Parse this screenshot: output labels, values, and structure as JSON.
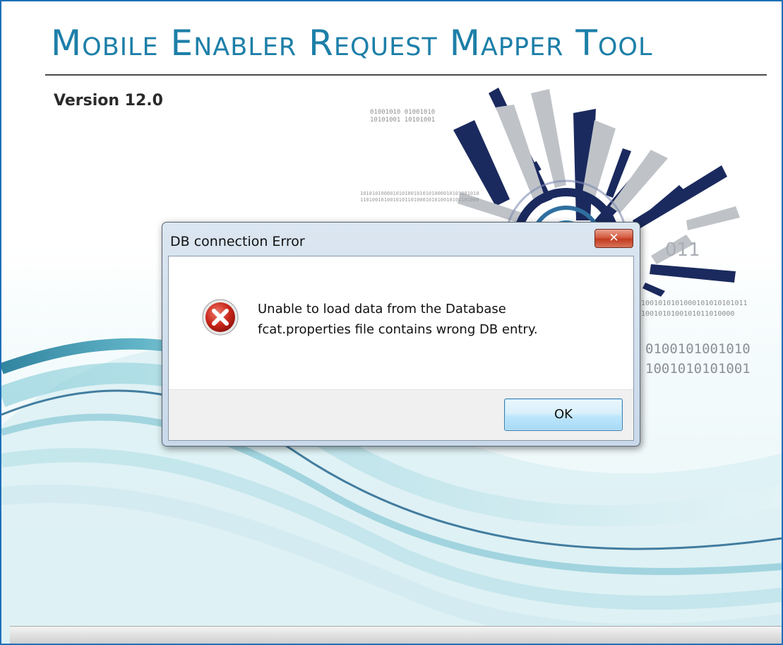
{
  "app": {
    "title": "Mobile Enabler Request Mapper Tool",
    "version": "Version 12.0",
    "binary_small": [
      "01001010  01001010",
      "10101001  10101001"
    ],
    "binary_mid": [
      "1010101000010101001010101000010101001010",
      "1101001010010101101000101010010101101000"
    ],
    "binary_right": [
      "1001010101000101010101011",
      "1001010100101011010000"
    ],
    "binary_large": [
      "0100101001010",
      "1001010101001"
    ],
    "binary_emblem": "011"
  },
  "dialog": {
    "title": "DB connection Error",
    "close_glyph": "✕",
    "icon": "error-icon",
    "message_line1": "Unable to load data from the Database",
    "message_line2": "fcat.properties file contains wrong DB entry.",
    "ok_label": "OK"
  },
  "colors": {
    "title": "#1d7fa8",
    "frame_border": "#1f6fb7",
    "emblem_navy": "#1b2a5e",
    "close_red": "#c23b20"
  }
}
